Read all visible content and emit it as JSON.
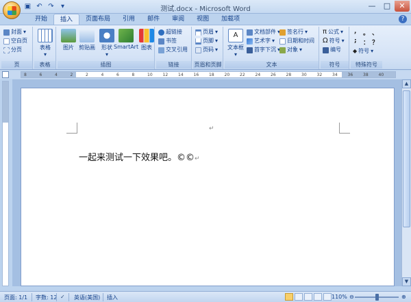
{
  "window": {
    "title": "测试.docx - Microsoft Word"
  },
  "qat": {
    "undo_icon": "undo-icon",
    "redo_icon": "redo-icon",
    "save_icon": "save-icon"
  },
  "tabs": [
    {
      "label": "开始"
    },
    {
      "label": "插入",
      "active": true
    },
    {
      "label": "页面布局"
    },
    {
      "label": "引用"
    },
    {
      "label": "邮件"
    },
    {
      "label": "审阅"
    },
    {
      "label": "视图"
    },
    {
      "label": "加载项"
    }
  ],
  "ribbon": {
    "pages": {
      "label": "页",
      "cover": "封面",
      "blank": "空白页",
      "break": "分页"
    },
    "tables": {
      "label": "表格",
      "table": "表格"
    },
    "illustrations": {
      "label": "插图",
      "picture": "图片",
      "clipart": "剪贴画",
      "shapes": "形状",
      "smartart": "SmartArt",
      "chart": "图表"
    },
    "links": {
      "label": "链接",
      "hyperlink": "超链接",
      "bookmark": "书签",
      "crossref": "交叉引用"
    },
    "headerfooter": {
      "label": "页眉和页脚",
      "header": "页眉",
      "footer": "页脚",
      "pagenum": "页码"
    },
    "text": {
      "label": "文本",
      "textbox": "文本框",
      "parts": "文档部件",
      "wordart": "艺术字",
      "dropcap": "首字下沉",
      "sigline": "签名行",
      "datetime": "日期和时间",
      "object": "对象"
    },
    "symbols": {
      "label": "符号",
      "equation": "公式",
      "symbol": "符号",
      "number": "编号"
    },
    "special": {
      "label": "特殊符号",
      "s1": ",",
      "s2": "。",
      "s3": "、",
      "s4": ";",
      "s5": "：",
      "s6": "？",
      "more": "符号"
    }
  },
  "ruler_numbers": [
    "8",
    "6",
    "4",
    "2",
    "2",
    "4",
    "6",
    "8",
    "10",
    "12",
    "14",
    "16",
    "18",
    "20",
    "22",
    "24",
    "26",
    "28",
    "30",
    "32",
    "34",
    "36",
    "38",
    "40"
  ],
  "document": {
    "text": "一起来测试一下效果吧。©©",
    "para_mark": "↵"
  },
  "status": {
    "page": "页面: 1/1",
    "words": "字数: 12",
    "language": "英语(美国)",
    "mode": "插入",
    "zoom": "110%"
  }
}
